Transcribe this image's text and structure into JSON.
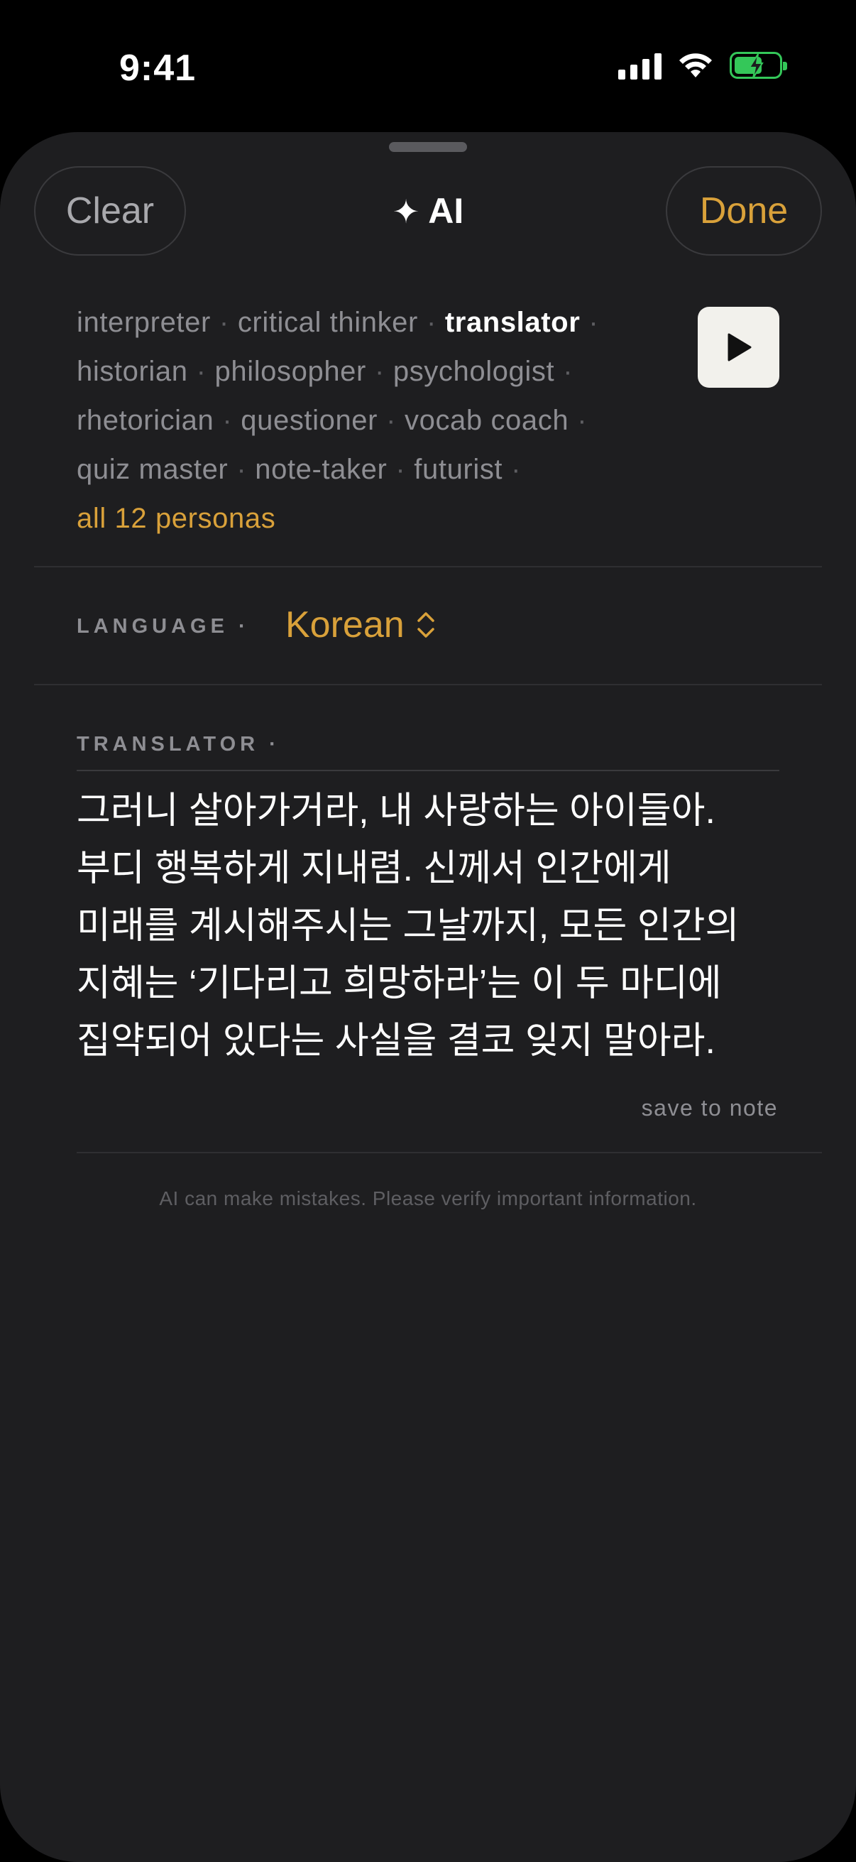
{
  "status_bar": {
    "time": "9:41",
    "icons": [
      "cellular-signal-icon",
      "wifi-icon",
      "battery-charging-icon"
    ],
    "battery_color": "#34c759"
  },
  "header": {
    "clear_label": "Clear",
    "title": "AI",
    "title_icon": "sparkle-icon",
    "done_label": "Done"
  },
  "personas": {
    "items": [
      {
        "label": "interpreter",
        "active": false
      },
      {
        "label": "critical thinker",
        "active": false
      },
      {
        "label": "translator",
        "active": true
      },
      {
        "label": "historian",
        "active": false
      },
      {
        "label": "philosopher",
        "active": false
      },
      {
        "label": "psychologist",
        "active": false
      },
      {
        "label": "rhetorician",
        "active": false
      },
      {
        "label": "questioner",
        "active": false
      },
      {
        "label": "vocab coach",
        "active": false
      },
      {
        "label": "quiz master",
        "active": false
      },
      {
        "label": "note-taker",
        "active": false
      },
      {
        "label": "futurist",
        "active": false
      }
    ],
    "separator": "·",
    "all_label": "all 12 personas",
    "play_icon": "play-icon"
  },
  "language": {
    "label": "LANGUAGE ·",
    "value": "Korean",
    "chevron_icon": "chevron-up-down-icon"
  },
  "output": {
    "label": "TRANSLATOR ·",
    "text": "그러니 살아가거라, 내 사랑하는 아이들아.\n부디 행복하게 지내렴. 신께서 인간에게\n미래를 계시해주시는 그날까지, 모든 인간의\n지혜는 ‘기다리고 희망하라’는 이 두 마디에\n집약되어 있다는 사실을 결코 잊지 말아라.",
    "save_label": "save to note"
  },
  "disclaimer": "AI can make mistakes. Please verify important information.",
  "colors": {
    "accent": "#d9a13a",
    "sheet_background": "#1e1e20",
    "muted_text": "#8e8e93"
  }
}
